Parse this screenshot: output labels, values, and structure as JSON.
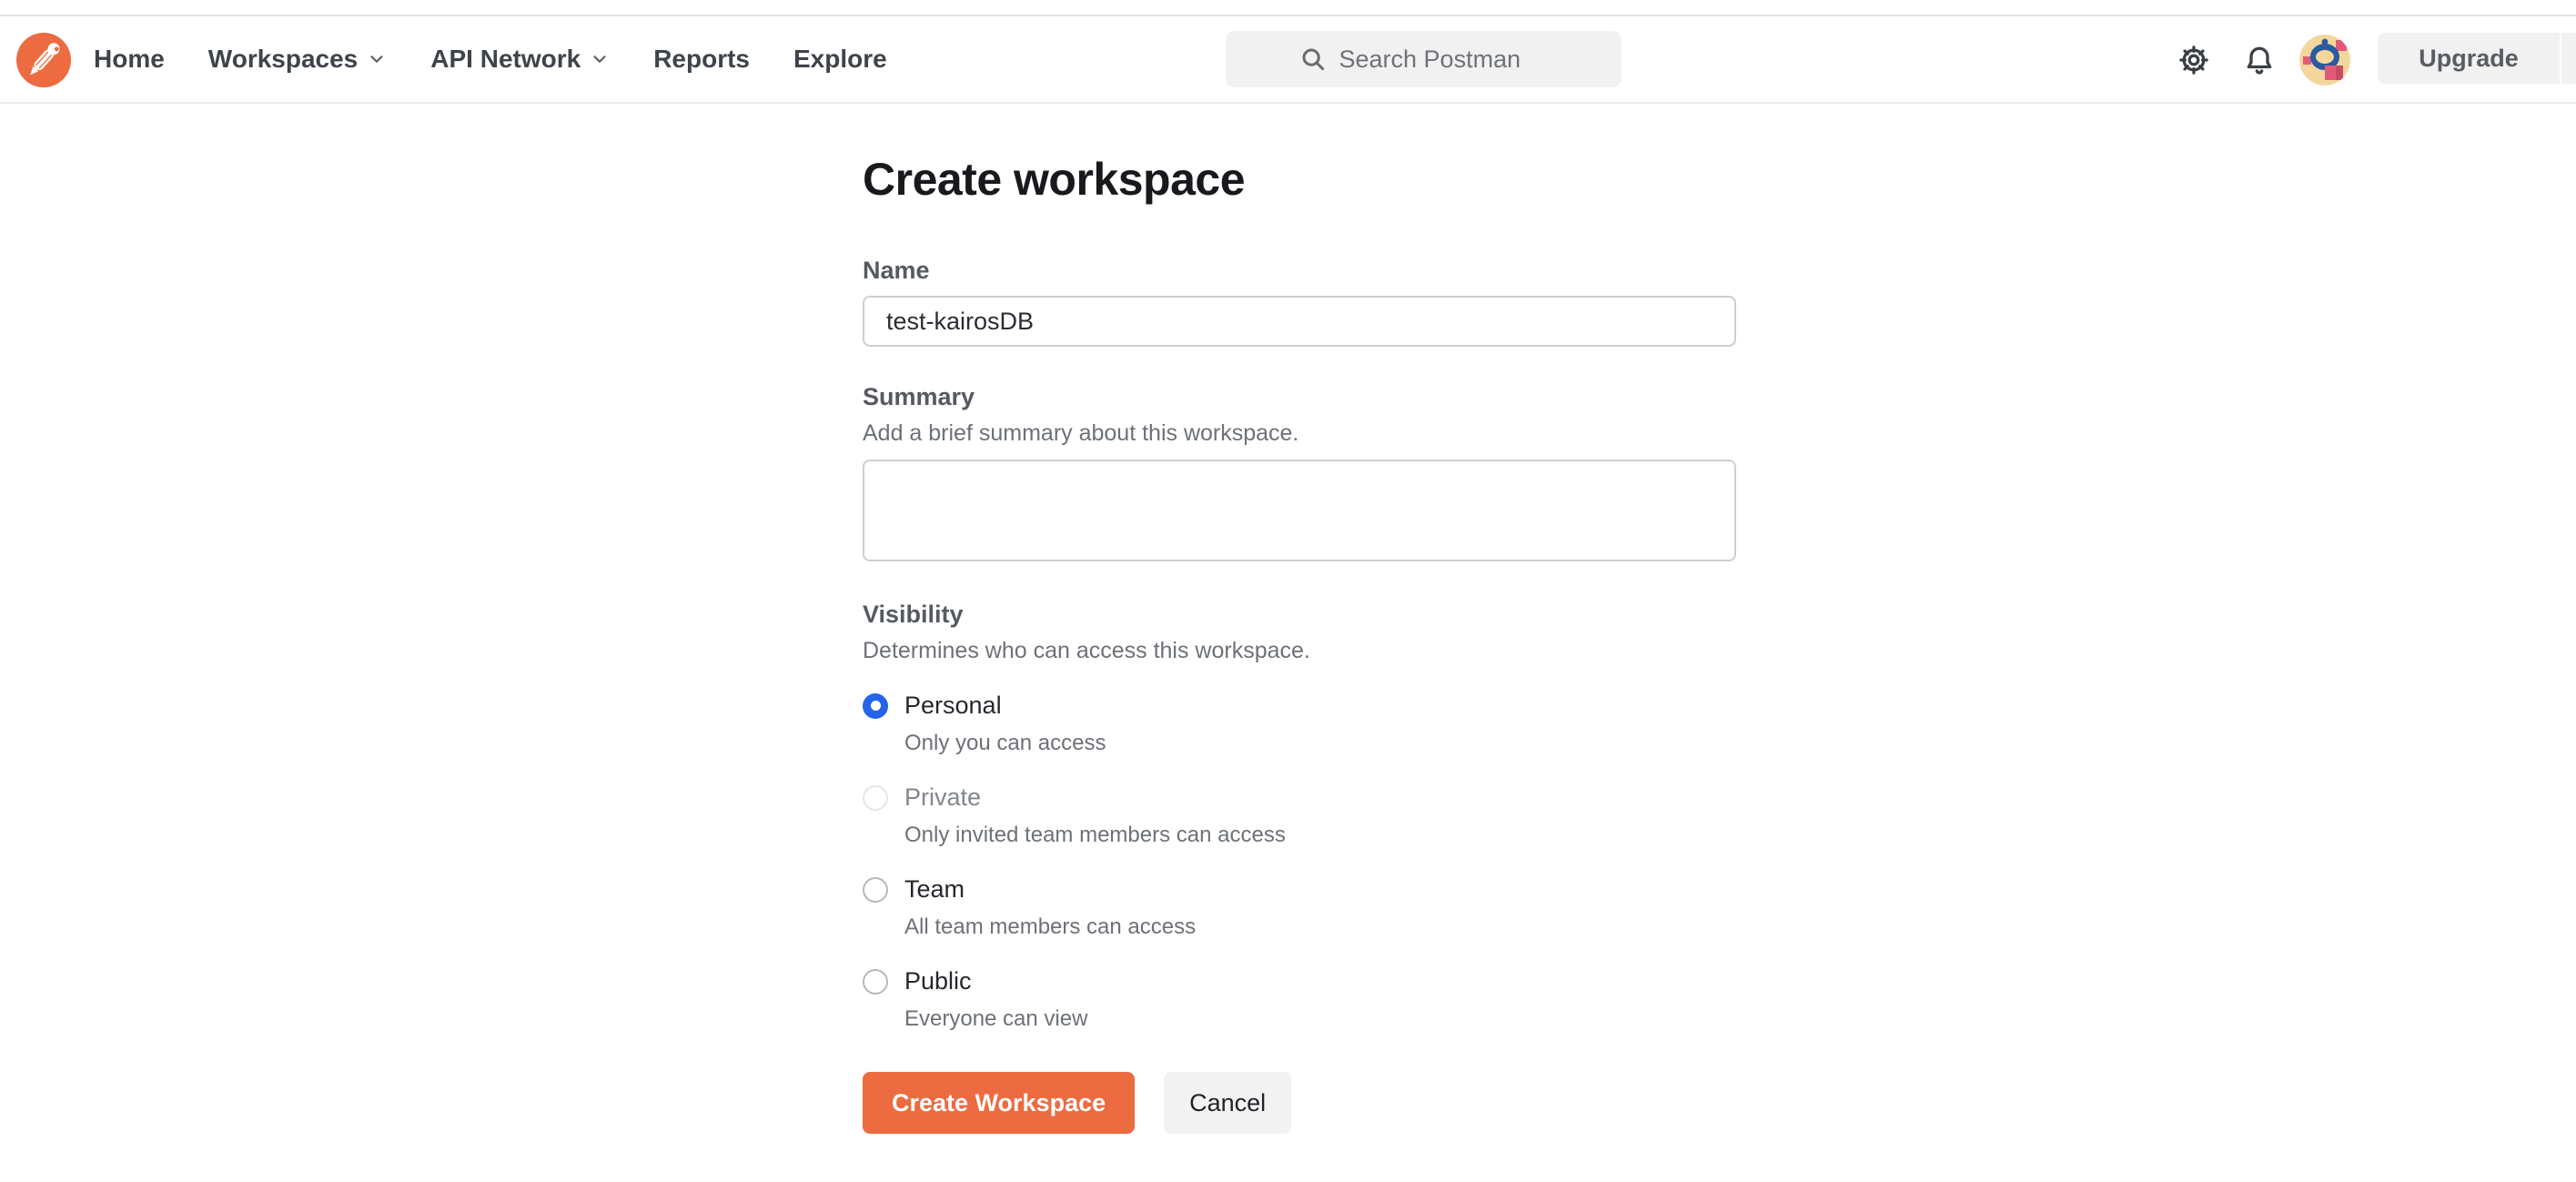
{
  "nav": {
    "links": [
      {
        "label": "Home",
        "dropdown": false
      },
      {
        "label": "Workspaces",
        "dropdown": true
      },
      {
        "label": "API Network",
        "dropdown": true
      },
      {
        "label": "Reports",
        "dropdown": false
      },
      {
        "label": "Explore",
        "dropdown": false
      }
    ],
    "search": {
      "placeholder": "Search Postman"
    },
    "upgrade_label": "Upgrade"
  },
  "form": {
    "title": "Create workspace",
    "name": {
      "label": "Name",
      "value": "test-kairosDB"
    },
    "summary": {
      "label": "Summary",
      "help": "Add a brief summary about this workspace.",
      "value": ""
    },
    "visibility": {
      "label": "Visibility",
      "help": "Determines who can access this workspace.",
      "options": [
        {
          "label": "Personal",
          "description": "Only you can access",
          "selected": true,
          "disabled": false
        },
        {
          "label": "Private",
          "description": "Only invited team members can access",
          "selected": false,
          "disabled": true
        },
        {
          "label": "Team",
          "description": "All team members can access",
          "selected": false,
          "disabled": false
        },
        {
          "label": "Public",
          "description": "Everyone can view",
          "selected": false,
          "disabled": false
        }
      ]
    },
    "submit_label": "Create Workspace",
    "cancel_label": "Cancel"
  },
  "colors": {
    "brand_orange": "#ed6b40",
    "radio_selected_blue": "#2563eb",
    "nav_border": "#ececec",
    "search_bg": "#f1f1f2"
  }
}
